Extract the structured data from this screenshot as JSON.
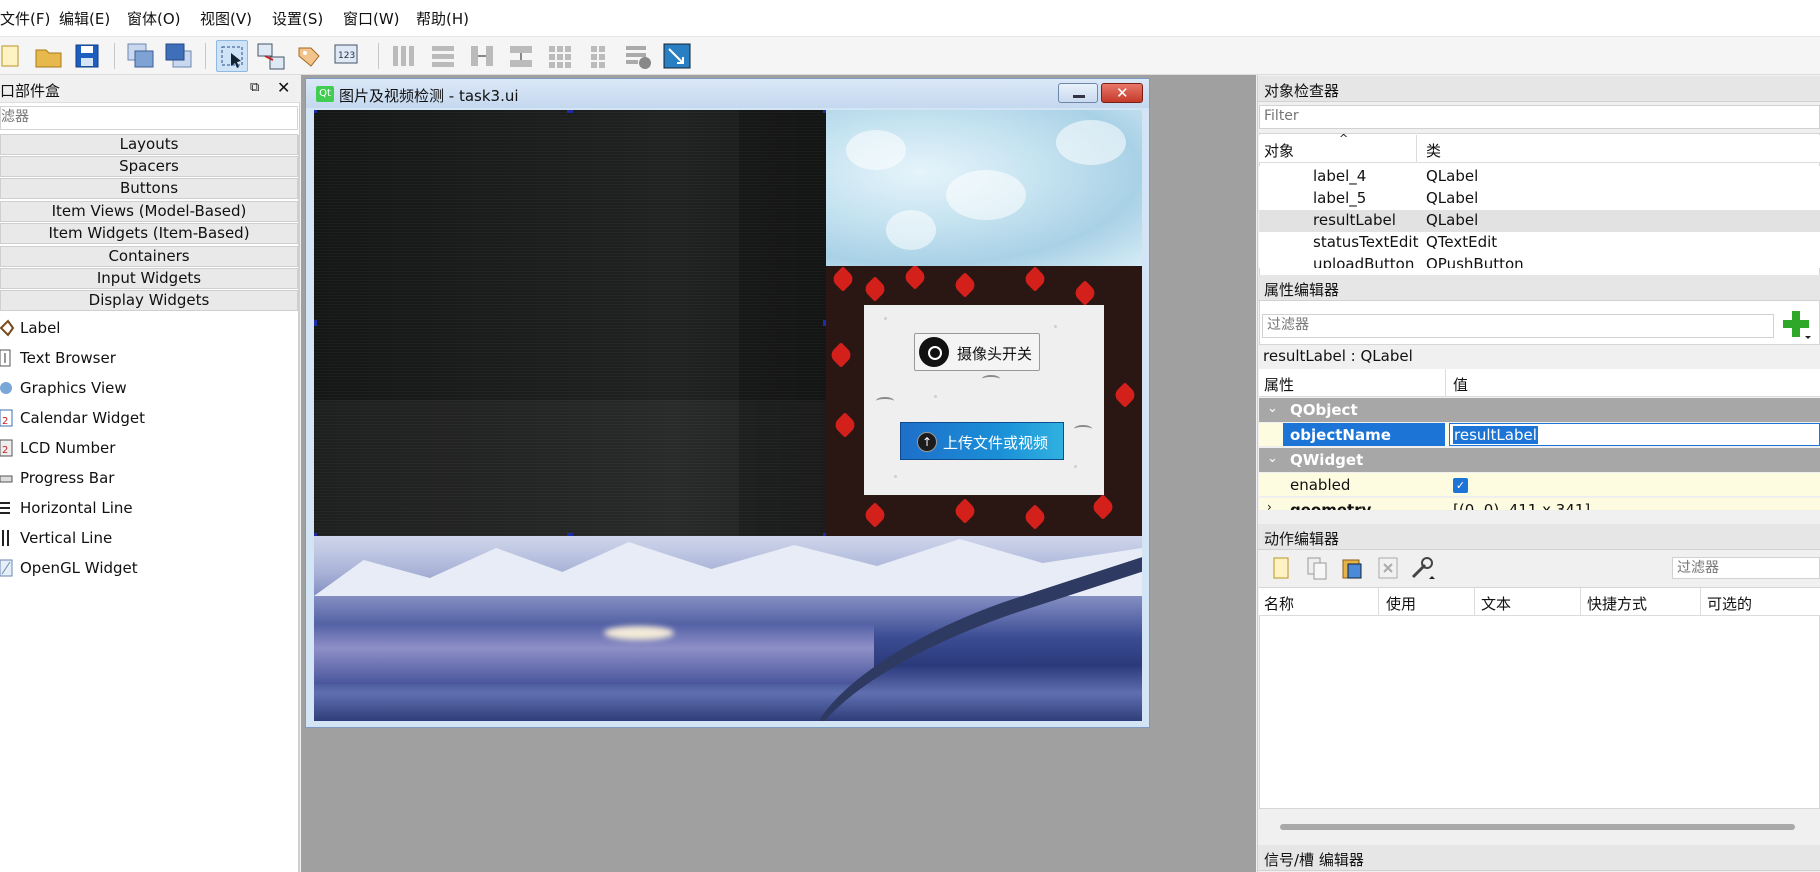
{
  "menubar": {
    "items": [
      "文件(F)",
      "编辑(E)",
      "窗体(O)",
      "视图(V)",
      "设置(S)",
      "窗口(W)",
      "帮助(H)"
    ]
  },
  "toolbar": {
    "icons": [
      "new-file-icon",
      "open-folder-icon",
      "save-icon",
      "send-to-back-icon",
      "bring-to-front-icon",
      "edit-widgets-icon",
      "edit-signals-slots-icon",
      "edit-buddies-icon",
      "edit-tab-order-icon",
      "layout-horizontal-icon",
      "layout-vertical-icon",
      "layout-horizontal-splitter-icon",
      "layout-vertical-splitter-icon",
      "layout-grid-icon",
      "layout-form-icon",
      "break-layout-icon",
      "adjust-size-icon"
    ]
  },
  "widget_box": {
    "title": "口部件盒",
    "filter_placeholder": "滤器",
    "categories": [
      "Layouts",
      "Spacers",
      "Buttons",
      "Item Views (Model-Based)",
      "Item Widgets (Item-Based)",
      "Containers",
      "Input Widgets",
      "Display Widgets"
    ],
    "items": [
      {
        "label": "Label",
        "icon": "label-icon"
      },
      {
        "label": "Text Browser",
        "icon": "text-browser-icon"
      },
      {
        "label": "Graphics View",
        "icon": "graphics-view-icon"
      },
      {
        "label": "Calendar Widget",
        "icon": "calendar-icon"
      },
      {
        "label": "LCD Number",
        "icon": "lcd-number-icon"
      },
      {
        "label": "Progress Bar",
        "icon": "progress-bar-icon"
      },
      {
        "label": "Horizontal Line",
        "icon": "horizontal-line-icon"
      },
      {
        "label": "Vertical Line",
        "icon": "vertical-line-icon"
      },
      {
        "label": "OpenGL Widget",
        "icon": "opengl-icon"
      }
    ]
  },
  "form_window": {
    "title": "图片及视频检测 - task3.ui",
    "qt_badge": "Qt",
    "camera_button": "摄像头开关",
    "upload_button": "上传文件或视频"
  },
  "object_inspector": {
    "title": "对象检查器",
    "filter_placeholder": "Filter",
    "col_object": "对象",
    "col_class": "类",
    "rows": [
      {
        "name": "label_4",
        "class": "QLabel",
        "selected": false
      },
      {
        "name": "label_5",
        "class": "QLabel",
        "selected": false
      },
      {
        "name": "resultLabel",
        "class": "QLabel",
        "selected": true
      },
      {
        "name": "statusTextEdit",
        "class": "QTextEdit",
        "selected": false
      },
      {
        "name": "uploadButton",
        "class": "QPushButton",
        "selected": false
      }
    ]
  },
  "property_editor": {
    "title": "属性编辑器",
    "filter_placeholder": "过滤器",
    "context": "resultLabel : QLabel",
    "col_property": "属性",
    "col_value": "值",
    "groups": [
      {
        "name": "QObject",
        "rows": [
          {
            "name": "objectName",
            "value": "resultLabel"
          }
        ]
      },
      {
        "name": "QWidget",
        "rows": [
          {
            "name": "enabled",
            "value": "✓"
          },
          {
            "name": "geometry",
            "value": "[(0, 0), 411 x 341]"
          }
        ]
      }
    ]
  },
  "action_editor": {
    "title": "动作编辑器",
    "filter_placeholder": "过滤器",
    "columns": [
      "名称",
      "使用",
      "文本",
      "快捷方式",
      "可选的"
    ]
  },
  "signal_slot_editor": {
    "title": "信号/槽 编辑器"
  }
}
